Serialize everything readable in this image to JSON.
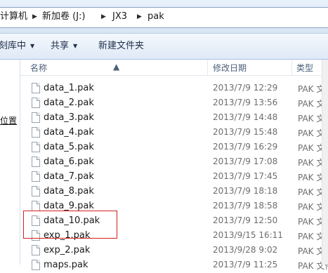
{
  "address": {
    "crumbs": [
      "计算机",
      "新加卷 (J:)",
      "JX3",
      "pak"
    ],
    "separator": "▶"
  },
  "toolbar": {
    "organize_label": "刻库中",
    "share_label": "共享",
    "new_folder_label": "新建文件夹"
  },
  "nav": {
    "link_label": "位置"
  },
  "columns": {
    "name": "名称",
    "modified": "修改日期",
    "type": "类型"
  },
  "files": [
    {
      "name": "data_1.pak",
      "modified": "2013/7/9 12:29",
      "type": "PAK 文件"
    },
    {
      "name": "data_2.pak",
      "modified": "2013/7/9 13:56",
      "type": "PAK 文件"
    },
    {
      "name": "data_3.pak",
      "modified": "2013/7/9 14:48",
      "type": "PAK 文件"
    },
    {
      "name": "data_4.pak",
      "modified": "2013/7/9 15:48",
      "type": "PAK 文件"
    },
    {
      "name": "data_5.pak",
      "modified": "2013/7/9 16:29",
      "type": "PAK 文件"
    },
    {
      "name": "data_6.pak",
      "modified": "2013/7/9 17:08",
      "type": "PAK 文件"
    },
    {
      "name": "data_7.pak",
      "modified": "2013/7/9 17:45",
      "type": "PAK 文件"
    },
    {
      "name": "data_8.pak",
      "modified": "2013/7/9 18:18",
      "type": "PAK 文件"
    },
    {
      "name": "data_9.pak",
      "modified": "2013/7/9 18:58",
      "type": "PAK 文件"
    },
    {
      "name": "data_10.pak",
      "modified": "2013/7/9 12:50",
      "type": "PAK 文件"
    },
    {
      "name": "exp_1.pak",
      "modified": "2013/9/15 16:11",
      "type": "PAK 文件"
    },
    {
      "name": "exp_2.pak",
      "modified": "2013/9/28 9:02",
      "type": "PAK 文件"
    },
    {
      "name": "maps.pak",
      "modified": "2013/7/9 11:25",
      "type": "PAK 文件"
    }
  ],
  "colors": {
    "highlight_box": "#d22020",
    "toolbar_top": "#f4f8fd",
    "toolbar_bottom": "#dfe9f6"
  }
}
